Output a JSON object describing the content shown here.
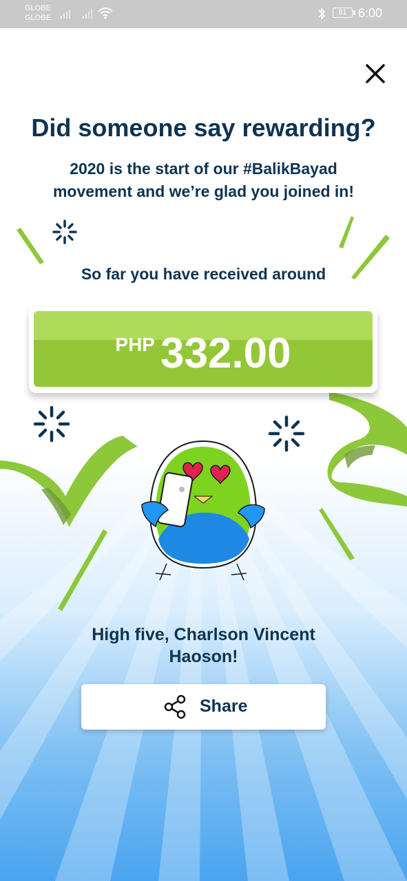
{
  "status_bar": {
    "carrier_1": "GLOBE",
    "carrier_2": "GLOBE",
    "battery": "81",
    "time": "6:00"
  },
  "modal": {
    "title": "Did someone say rewarding?",
    "subtitle_line1": "2020 is the start of our #BalikBayad",
    "subtitle_line2": "movement and we’re glad you joined in!",
    "received_label": "So far you have received around",
    "amount": {
      "currency": "PHP",
      "value": "332.00"
    },
    "greeting_line1": "High five, Charlson Vincent",
    "greeting_line2": "Haoson!",
    "share_label": "Share"
  },
  "icons": {
    "close": "close-icon",
    "share": "share-icon",
    "signal": "signal-icon",
    "wifi": "wifi-icon",
    "bluetooth": "bluetooth-icon",
    "battery": "battery-icon"
  },
  "colors": {
    "heading_text": "#0e3451",
    "amount_green_top": "#aedb59",
    "amount_green_bottom": "#94c737",
    "ribbon_green": "#8cc83a",
    "mascot_green": "#7ed321",
    "mascot_blue": "#1e88e5",
    "background_blue": "#4aa4f0"
  }
}
